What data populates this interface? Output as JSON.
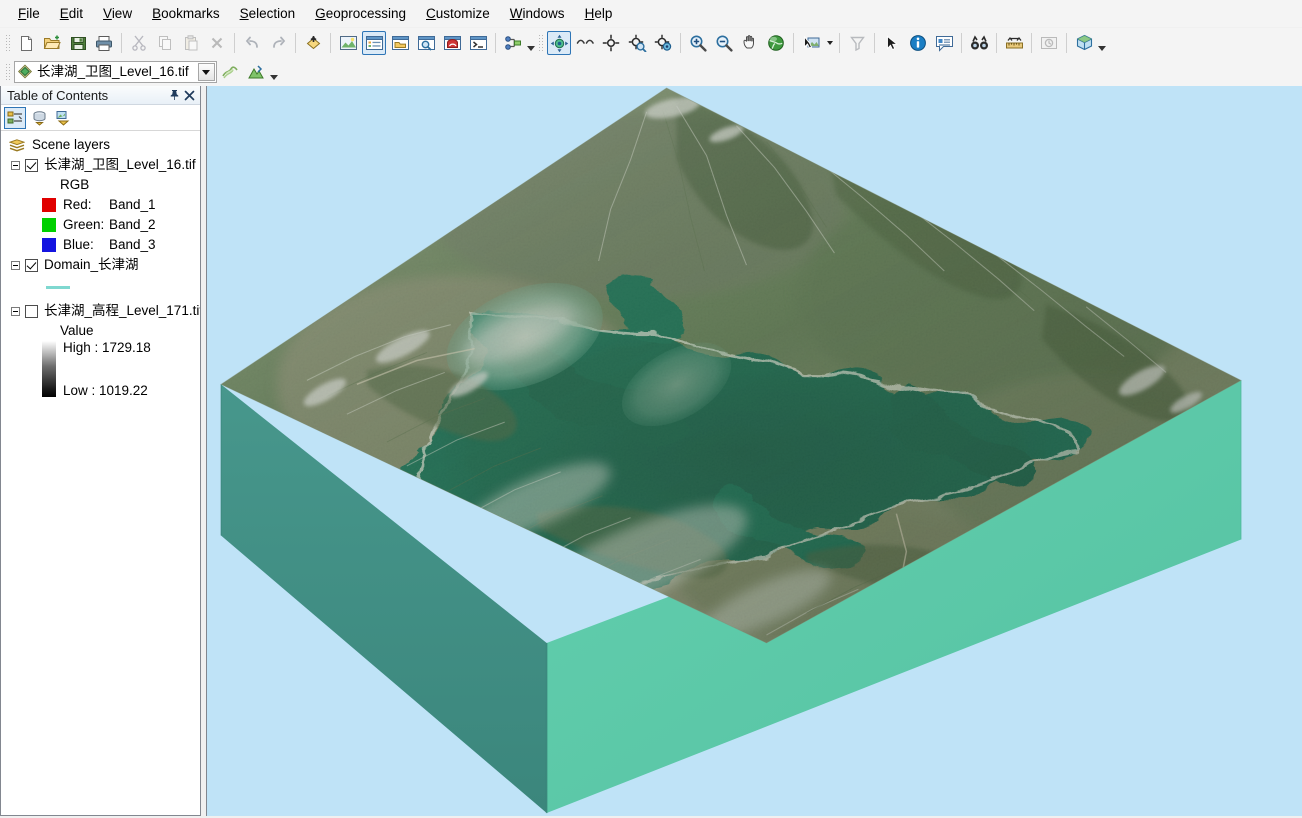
{
  "menubar": {
    "items": [
      {
        "label": "File",
        "accel": "F"
      },
      {
        "label": "Edit",
        "accel": "E"
      },
      {
        "label": "View",
        "accel": "V"
      },
      {
        "label": "Bookmarks",
        "accel": "B"
      },
      {
        "label": "Selection",
        "accel": "S"
      },
      {
        "label": "Geoprocessing",
        "accel": "G"
      },
      {
        "label": "Customize",
        "accel": "C"
      },
      {
        "label": "Windows",
        "accel": "W"
      },
      {
        "label": "Help",
        "accel": "H"
      }
    ]
  },
  "standard_toolbar": {
    "buttons": [
      {
        "name": "new-document-icon",
        "tip": "New"
      },
      {
        "name": "open-folder-icon",
        "tip": "Open"
      },
      {
        "name": "save-icon",
        "tip": "Save"
      },
      {
        "name": "print-icon",
        "tip": "Print"
      },
      {
        "name": "cut-icon",
        "tip": "Cut"
      },
      {
        "name": "copy-icon",
        "tip": "Copy"
      },
      {
        "name": "paste-icon",
        "tip": "Paste"
      },
      {
        "name": "delete-icon",
        "tip": "Delete"
      },
      {
        "name": "undo-icon",
        "tip": "Undo"
      },
      {
        "name": "redo-icon",
        "tip": "Redo"
      },
      {
        "name": "add-data-icon",
        "tip": "Add Data"
      },
      {
        "name": "scene-properties-icon",
        "tip": "Scene Properties"
      },
      {
        "name": "table-of-contents-icon",
        "tip": "Table Of Contents"
      },
      {
        "name": "catalog-window-icon",
        "tip": "Catalog"
      },
      {
        "name": "search-window-icon",
        "tip": "Search"
      },
      {
        "name": "arctoolbox-icon",
        "tip": "ArcToolbox"
      },
      {
        "name": "python-window-icon",
        "tip": "Python Window"
      },
      {
        "name": "model-builder-icon",
        "tip": "ModelBuilder"
      }
    ]
  },
  "tools_toolbar": {
    "buttons": [
      {
        "name": "navigate-icon",
        "tip": "Navigate"
      },
      {
        "name": "fly-icon",
        "tip": "Fly"
      },
      {
        "name": "center-on-target-icon",
        "tip": "Center on Target"
      },
      {
        "name": "zoom-to-target-icon",
        "tip": "Zoom to Target"
      },
      {
        "name": "set-observer-icon",
        "tip": "Set Observer"
      },
      {
        "name": "zoom-in-icon",
        "tip": "Zoom In"
      },
      {
        "name": "zoom-out-icon",
        "tip": "Zoom Out"
      },
      {
        "name": "pan-icon",
        "tip": "Pan"
      },
      {
        "name": "full-extent-icon",
        "tip": "Full Extent"
      },
      {
        "name": "select-features-icon",
        "tip": "Select Features"
      },
      {
        "name": "clear-selection-icon",
        "tip": "Clear Selected Features"
      },
      {
        "name": "select-elements-icon",
        "tip": "Select Elements"
      },
      {
        "name": "identify-icon",
        "tip": "Identify"
      },
      {
        "name": "html-popup-icon",
        "tip": "HTML Popup"
      },
      {
        "name": "find-icon",
        "tip": "Find"
      },
      {
        "name": "measure-icon",
        "tip": "Measure"
      },
      {
        "name": "time-slider-icon",
        "tip": "Time Slider"
      },
      {
        "name": "scene-cube-icon",
        "tip": "3D Effects"
      }
    ]
  },
  "layer_toolbar": {
    "selected_layer": "长津湖_卫图_Level_16.tif",
    "icon": "raster-layer-icon",
    "buttons": [
      {
        "name": "layer-transparency-icon",
        "tip": "Layer Transparency"
      },
      {
        "name": "layer-face-culling-icon",
        "tip": "Layer Face Culling"
      }
    ]
  },
  "toc": {
    "title": "Table of Contents",
    "pin_icon": "pin-icon",
    "close_icon": "close-icon",
    "tools": [
      {
        "name": "list-by-drawing-order-icon",
        "label": "List By Drawing Order",
        "selected": true
      },
      {
        "name": "list-by-source-icon",
        "label": "List By Source",
        "selected": false
      },
      {
        "name": "list-by-visibility-icon",
        "label": "List By Visibility",
        "selected": false
      }
    ],
    "root": "Scene layers",
    "root_icon": "scene-layers-icon",
    "layers": [
      {
        "name": "长津湖_卫图_Level_16.tif",
        "checked": true,
        "type": "rgb-raster",
        "group_label": "RGB",
        "bands": [
          {
            "channel": "Red:",
            "band": "Band_1",
            "color": "#e00000"
          },
          {
            "channel": "Green:",
            "band": "Band_2",
            "color": "#00d000"
          },
          {
            "channel": "Blue:",
            "band": "Band_3",
            "color": "#1414e0"
          }
        ]
      },
      {
        "name": "Domain_长津湖",
        "checked": true,
        "type": "polyline",
        "symbol_color": "#7fd8d0"
      },
      {
        "name": "长津湖_高程_Level_171.tif",
        "checked": false,
        "type": "stretched-raster",
        "value_label": "Value",
        "high_label": "High : 1729.18",
        "low_label": "Low : 1019.22",
        "ramp_top": "#ffffff",
        "ramp_bottom": "#000000"
      }
    ]
  },
  "scene": {
    "name": "3d-scene-view",
    "background_color": "#bfe3f7",
    "block_side_left_color": "#3f8d83",
    "block_side_right_color": "#5ecaa9",
    "block_front_color": "#57c3a4",
    "water_color": "#0e6b50",
    "terrain_description": "3D perspective extruded terrain block of the Changjin Lake reservoir with forested ridges and a dark green branching lake"
  },
  "colors": {
    "accent": "#2e75b6",
    "panel_bg": "#f4f4f4",
    "scene_bg": "#bfe3f7"
  }
}
